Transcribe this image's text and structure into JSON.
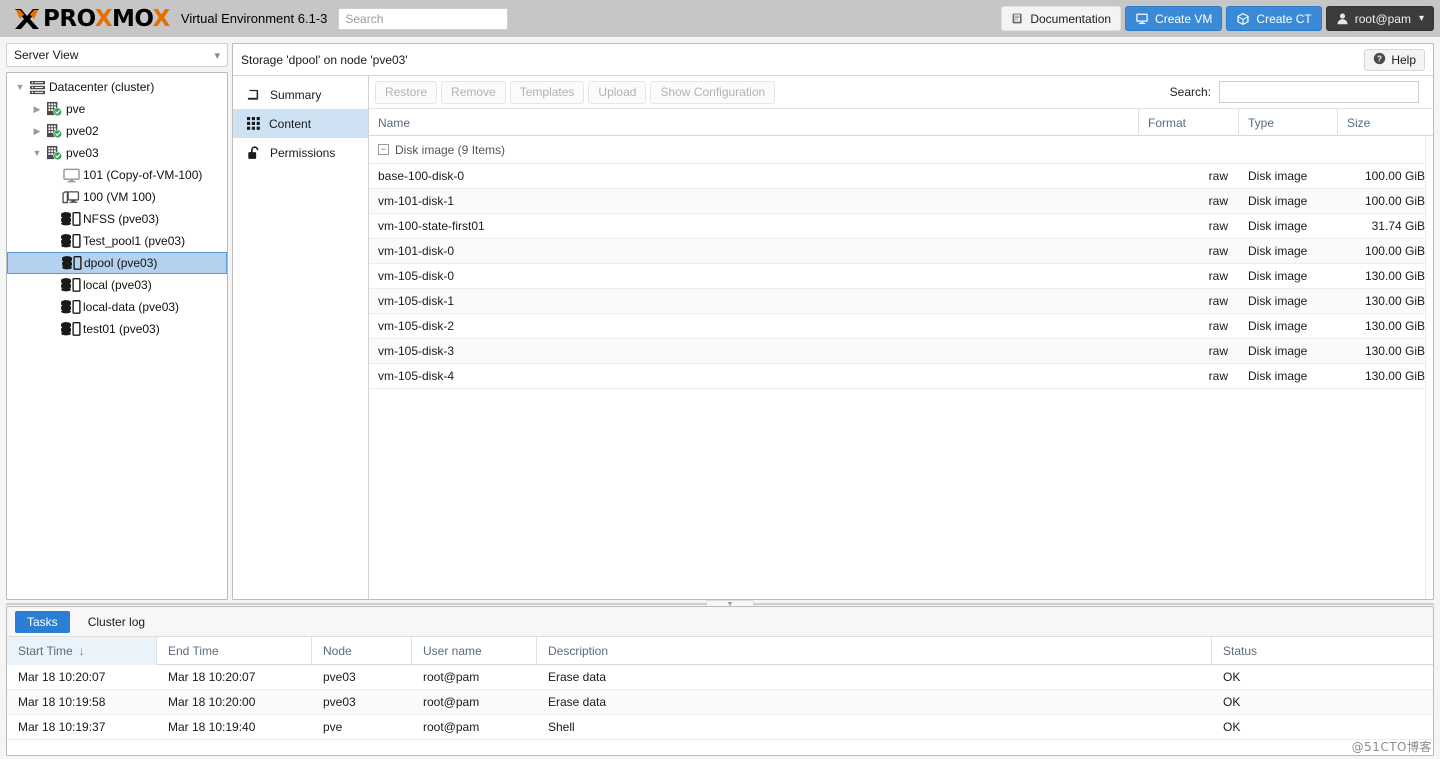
{
  "topbar": {
    "logo_text": "PROXMOX",
    "product_name": "Virtual Environment 6.1-3",
    "search_placeholder": "Search",
    "search_value": "",
    "buttons": [
      {
        "label": "Documentation",
        "icon": "book-icon",
        "style": "light"
      },
      {
        "label": "Create VM",
        "icon": "monitor-icon",
        "style": "blue"
      },
      {
        "label": "Create CT",
        "icon": "cube-icon",
        "style": "blue"
      },
      {
        "label": "root@pam",
        "icon": "user-icon",
        "style": "dark",
        "caret": "⌄"
      }
    ]
  },
  "sidebar": {
    "view_select": {
      "label": "Server View",
      "caret": "⌄"
    },
    "items": [
      {
        "label": "Datacenter (cluster)",
        "icon": "datacenter-icon",
        "indent": 0,
        "expander": "▼",
        "selected": false
      },
      {
        "label": "pve",
        "icon": "node-icon",
        "indent": 1,
        "expander": "▶",
        "selected": false
      },
      {
        "label": "pve02",
        "icon": "node-icon",
        "indent": 1,
        "expander": "▶",
        "selected": false
      },
      {
        "label": "pve03",
        "icon": "node-icon",
        "indent": 1,
        "expander": "▼",
        "selected": false
      },
      {
        "label": "101 (Copy-of-VM-100)",
        "icon": "vm-icon",
        "indent": 2,
        "expander": "",
        "selected": false
      },
      {
        "label": "100 (VM 100)",
        "icon": "template-icon",
        "indent": 2,
        "expander": "",
        "selected": false
      },
      {
        "label": "NFSS (pve03)",
        "icon": "storage-icon",
        "indent": 2,
        "expander": "",
        "selected": false
      },
      {
        "label": "Test_pool1 (pve03)",
        "icon": "storage-icon",
        "indent": 2,
        "expander": "",
        "selected": false
      },
      {
        "label": "dpool (pve03)",
        "icon": "storage-icon",
        "indent": 2,
        "expander": "",
        "selected": true
      },
      {
        "label": "local (pve03)",
        "icon": "storage-icon",
        "indent": 2,
        "expander": "",
        "selected": false
      },
      {
        "label": "local-data (pve03)",
        "icon": "storage-icon",
        "indent": 2,
        "expander": "",
        "selected": false
      },
      {
        "label": "test01 (pve03)",
        "icon": "storage-icon",
        "indent": 2,
        "expander": "",
        "selected": false
      }
    ]
  },
  "main": {
    "title": "Storage 'dpool' on node 'pve03'",
    "help_label": "Help",
    "tabs": [
      {
        "label": "Summary",
        "icon": "book-icon",
        "active": false
      },
      {
        "label": "Content",
        "icon": "grid-icon",
        "active": true
      },
      {
        "label": "Permissions",
        "icon": "lock-icon",
        "active": false
      }
    ],
    "toolbar": {
      "buttons": [
        "Restore",
        "Remove",
        "Templates",
        "Upload",
        "Show Configuration"
      ],
      "search_label": "Search:",
      "search_value": "",
      "search_placeholder": ""
    },
    "grid": {
      "columns": [
        "Name",
        "Format",
        "Type",
        "Size"
      ],
      "group": {
        "toggle": "−",
        "label": "Disk image (9 Items)"
      },
      "rows": [
        {
          "name": "base-100-disk-0",
          "format": "raw",
          "type": "Disk image",
          "size": "100.00 GiB"
        },
        {
          "name": "vm-101-disk-1",
          "format": "raw",
          "type": "Disk image",
          "size": "100.00 GiB"
        },
        {
          "name": "vm-100-state-first01",
          "format": "raw",
          "type": "Disk image",
          "size": "31.74 GiB"
        },
        {
          "name": "vm-101-disk-0",
          "format": "raw",
          "type": "Disk image",
          "size": "100.00 GiB"
        },
        {
          "name": "vm-105-disk-0",
          "format": "raw",
          "type": "Disk image",
          "size": "130.00 GiB"
        },
        {
          "name": "vm-105-disk-1",
          "format": "raw",
          "type": "Disk image",
          "size": "130.00 GiB"
        },
        {
          "name": "vm-105-disk-2",
          "format": "raw",
          "type": "Disk image",
          "size": "130.00 GiB"
        },
        {
          "name": "vm-105-disk-3",
          "format": "raw",
          "type": "Disk image",
          "size": "130.00 GiB"
        },
        {
          "name": "vm-105-disk-4",
          "format": "raw",
          "type": "Disk image",
          "size": "130.00 GiB"
        }
      ]
    }
  },
  "bottom": {
    "tabs": [
      {
        "label": "Tasks",
        "active": true
      },
      {
        "label": "Cluster log",
        "active": false
      }
    ],
    "columns": [
      "Start Time",
      "End Time",
      "Node",
      "User name",
      "Description",
      "Status"
    ],
    "sort_indicator": "↓",
    "rows": [
      {
        "start": "Mar 18 10:20:07",
        "end": "Mar 18 10:20:07",
        "node": "pve03",
        "user": "root@pam",
        "desc": "Erase data",
        "status": "OK"
      },
      {
        "start": "Mar 18 10:19:58",
        "end": "Mar 18 10:20:00",
        "node": "pve03",
        "user": "root@pam",
        "desc": "Erase data",
        "status": "OK"
      },
      {
        "start": "Mar 18 10:19:37",
        "end": "Mar 18 10:19:40",
        "node": "pve",
        "user": "root@pam",
        "desc": "Shell",
        "status": "OK"
      }
    ]
  },
  "watermark": "@51CTO博客",
  "colors": {
    "accent_blue": "#3a8ad8",
    "tab_active_bg": "#cfe2f3",
    "tree_selected_bg": "#b4d2ef",
    "topbar_bg": "#c6c6c6",
    "logo_orange": "#e57000",
    "status_ok": "#1a1a1a"
  }
}
